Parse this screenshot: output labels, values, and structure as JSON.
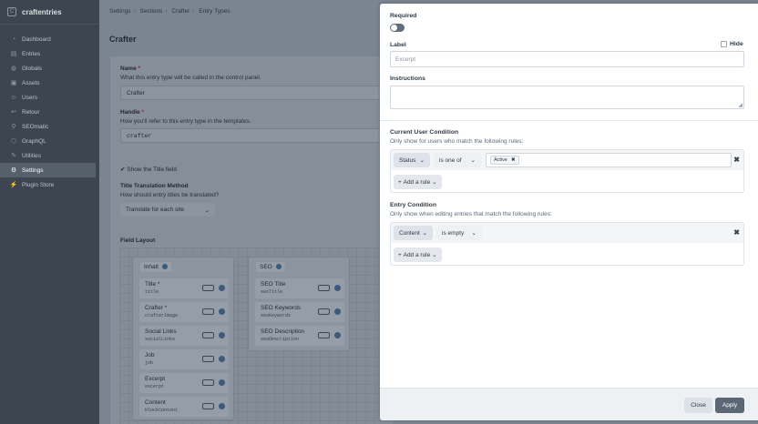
{
  "app": {
    "name": "craftentries"
  },
  "sidebar": {
    "items": [
      {
        "label": "Dashboard",
        "icon": "dashboard-icon",
        "glyph": "◔"
      },
      {
        "label": "Entries",
        "icon": "entries-icon",
        "glyph": "▤"
      },
      {
        "label": "Globals",
        "icon": "globe-icon",
        "glyph": "◍"
      },
      {
        "label": "Assets",
        "icon": "assets-icon",
        "glyph": "▣"
      },
      {
        "label": "Users",
        "icon": "users-icon",
        "glyph": "☺"
      },
      {
        "label": "Retour",
        "icon": "retour-icon",
        "glyph": "↩"
      },
      {
        "label": "SEOmatic",
        "icon": "seomatic-icon",
        "glyph": "⚲"
      },
      {
        "label": "GraphQL",
        "icon": "graphql-icon",
        "glyph": "⬡"
      },
      {
        "label": "Utilities",
        "icon": "utilities-icon",
        "glyph": "✎"
      },
      {
        "label": "Settings",
        "icon": "gear-icon",
        "glyph": "⚙",
        "active": true
      },
      {
        "label": "Plugin Store",
        "icon": "plug-icon",
        "glyph": "⚡"
      }
    ]
  },
  "breadcrumb": [
    "Settings",
    "Sections",
    "Crafter",
    "Entry Types"
  ],
  "page": {
    "title": "Crafter",
    "name_label": "Name",
    "name_help": "What this entry type will be called in the control panel.",
    "name_value": "Crafter",
    "handle_label": "Handle",
    "handle_help": "How you'll refer to this entry type in the templates.",
    "handle_value": "crafter",
    "show_title_label": "Show the Title field",
    "title_translation_label": "Title Translation Method",
    "title_translation_help": "How should entry titles be translated?",
    "title_translation_value": "Translate for each site",
    "field_layout_label": "Field Layout",
    "required_marker": "*",
    "checkmark": "✔",
    "chevron": "⌄"
  },
  "field_layout": {
    "tabs": [
      {
        "name": "Inhalt",
        "fields": [
          {
            "name": "Title",
            "required": true,
            "handle": "title"
          },
          {
            "name": "Crafter",
            "required": true,
            "handle": "crafterImage"
          },
          {
            "name": "Social Links",
            "required": false,
            "handle": "socialLinks"
          },
          {
            "name": "Job",
            "required": false,
            "handle": "job"
          },
          {
            "name": "Excerpt",
            "required": false,
            "handle": "excerpt"
          },
          {
            "name": "Content",
            "required": false,
            "handle": "blockContent"
          }
        ]
      },
      {
        "name": "SEO",
        "fields": [
          {
            "name": "SEO Title",
            "required": false,
            "handle": "seoTitle"
          },
          {
            "name": "SEO Keywords",
            "required": false,
            "handle": "seoKeywords"
          },
          {
            "name": "SEO Description",
            "required": false,
            "handle": "seoDescription"
          }
        ]
      }
    ]
  },
  "slideout": {
    "required_label": "Required",
    "label_label": "Label",
    "hide_label": "Hide",
    "label_placeholder": "Excerpt",
    "instructions_label": "Instructions",
    "user_condition": {
      "title": "Current User Condition",
      "help": "Only show for users who match the following rules:",
      "rule_attr": "Status",
      "rule_op": "is one of",
      "rule_tag": "Active",
      "add_rule": "Add a rule"
    },
    "entry_condition": {
      "title": "Entry Condition",
      "help": "Only show when editing entries that match the following rules:",
      "rule_attr": "Content",
      "rule_op": "is empty",
      "add_rule": "Add a rule"
    },
    "close_label": "Close",
    "apply_label": "Apply",
    "remove_glyph": "✖",
    "plus_glyph": "+",
    "resize_glyph": "◢"
  }
}
